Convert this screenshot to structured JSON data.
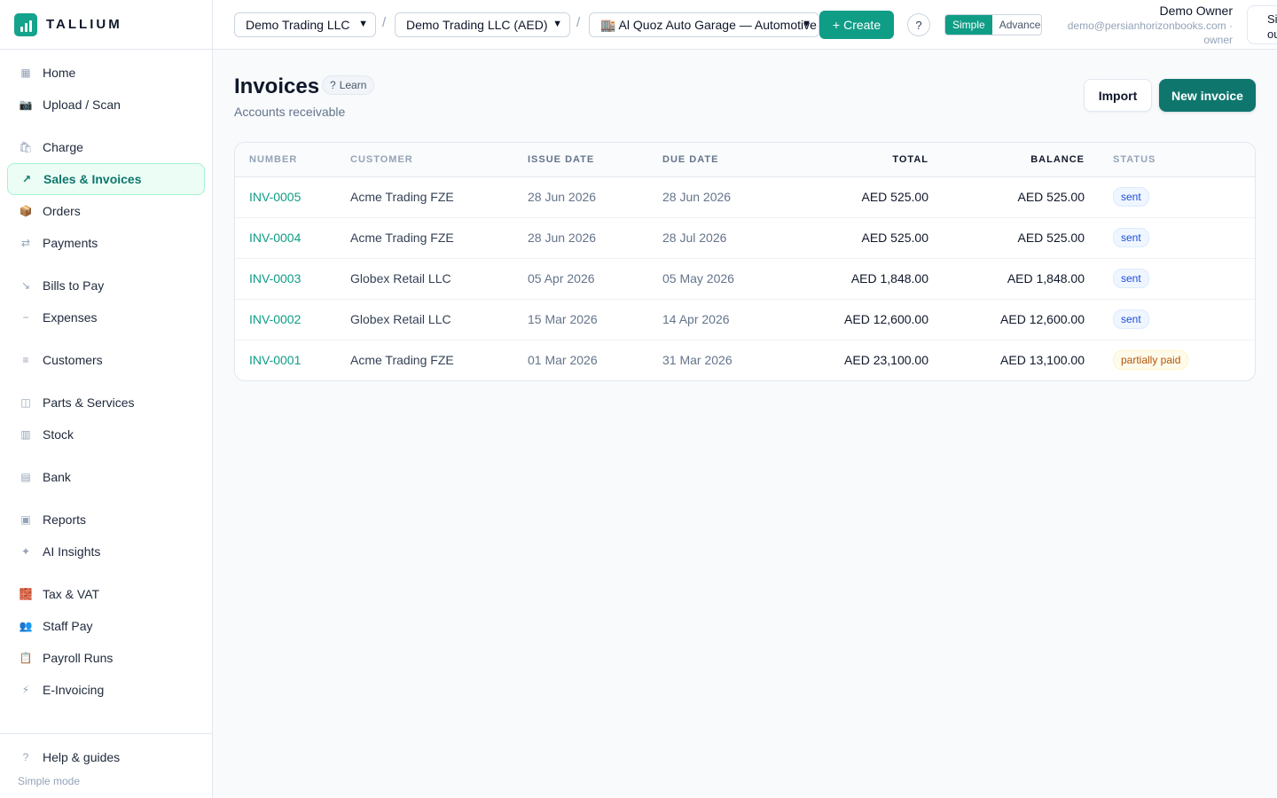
{
  "brand": {
    "name": "TALLIUM",
    "color": "#14a38b"
  },
  "sidebar": {
    "items": [
      {
        "label": "Home",
        "icon": "grid-icon",
        "glyph": "▦"
      },
      {
        "label": "Upload / Scan",
        "icon": "camera-icon",
        "glyph": "📷"
      },
      {
        "label": "Charge",
        "icon": "shopping-bag-icon",
        "glyph": "🛍"
      },
      {
        "label": "Sales & Invoices",
        "icon": "arrow-up-right-icon",
        "glyph": "↗"
      },
      {
        "label": "Orders",
        "icon": "package-icon",
        "glyph": "📦"
      },
      {
        "label": "Payments",
        "icon": "arrows-exchange-icon",
        "glyph": "⇄"
      },
      {
        "label": "Bills to Pay",
        "icon": "arrow-down-right-icon",
        "glyph": "↘"
      },
      {
        "label": "Expenses",
        "icon": "minus-icon",
        "glyph": "−"
      },
      {
        "label": "Customers",
        "icon": "list-icon",
        "glyph": "≡"
      },
      {
        "label": "Parts & Services",
        "icon": "box-icon",
        "glyph": "◫"
      },
      {
        "label": "Stock",
        "icon": "shelves-icon",
        "glyph": "▥"
      },
      {
        "label": "Bank",
        "icon": "bank-icon",
        "glyph": "▤"
      },
      {
        "label": "Reports",
        "icon": "report-icon",
        "glyph": "▣"
      },
      {
        "label": "AI Insights",
        "icon": "sparkle-icon",
        "glyph": "✦"
      },
      {
        "label": "Tax & VAT",
        "icon": "abacus-icon",
        "glyph": "🧱"
      },
      {
        "label": "Staff Pay",
        "icon": "people-icon",
        "glyph": "👥"
      },
      {
        "label": "Payroll Runs",
        "icon": "clipboard-icon",
        "glyph": "📋"
      },
      {
        "label": "E-Invoicing",
        "icon": "lightning-icon",
        "glyph": "⚡"
      }
    ],
    "footer": {
      "help_label": "Help & guides",
      "mode_label": "Simple mode"
    }
  },
  "topbar": {
    "company": "Demo Trading LLC",
    "entity": "Demo Trading LLC (AED)",
    "branch": "🏬 Al Quoz Auto Garage — Automotive",
    "create_label": "Create",
    "help_label": "?",
    "mode_simple": "Simple",
    "mode_advanced": "Advanced",
    "user_name": "Demo Owner",
    "user_email": "demo@persianhorizonbooks.com · owner",
    "signout_label": "Sign out"
  },
  "page": {
    "title": "Invoices",
    "learn_label": "Learn",
    "subtitle": "Accounts receivable",
    "import_label": "Import",
    "new_label": "New invoice"
  },
  "table": {
    "headers": [
      "NUMBER",
      "CUSTOMER",
      "ISSUE DATE",
      "DUE DATE",
      "TOTAL",
      "BALANCE",
      "STATUS"
    ],
    "rows": [
      {
        "number": "INV-0005",
        "customer": "Acme Trading FZE",
        "issue": "28 Jun 2026",
        "due": "28 Jun 2026",
        "total": "AED 525.00",
        "balance": "AED 525.00",
        "status": "sent"
      },
      {
        "number": "INV-0004",
        "customer": "Acme Trading FZE",
        "issue": "28 Jun 2026",
        "due": "28 Jul 2026",
        "total": "AED 525.00",
        "balance": "AED 525.00",
        "status": "sent"
      },
      {
        "number": "INV-0003",
        "customer": "Globex Retail LLC",
        "issue": "05 Apr 2026",
        "due": "05 May 2026",
        "total": "AED 1,848.00",
        "balance": "AED 1,848.00",
        "status": "sent"
      },
      {
        "number": "INV-0002",
        "customer": "Globex Retail LLC",
        "issue": "15 Mar 2026",
        "due": "14 Apr 2026",
        "total": "AED 12,600.00",
        "balance": "AED 12,600.00",
        "status": "sent"
      },
      {
        "number": "INV-0001",
        "customer": "Acme Trading FZE",
        "issue": "01 Mar 2026",
        "due": "31 Mar 2026",
        "total": "AED 23,100.00",
        "balance": "AED 13,100.00",
        "status": "partially paid"
      }
    ]
  },
  "colors": {
    "accent": "#0f9d86",
    "primary_button": "#0f766e",
    "sent_badge": "#1d4ed8",
    "partial_badge": "#b45309"
  }
}
